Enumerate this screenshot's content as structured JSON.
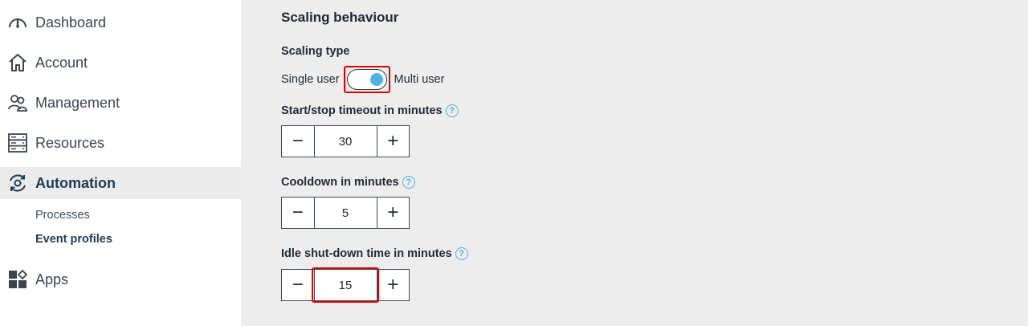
{
  "sidebar": {
    "items": [
      {
        "label": "Dashboard",
        "icon": "gauge-icon"
      },
      {
        "label": "Account",
        "icon": "home-icon"
      },
      {
        "label": "Management",
        "icon": "users-icon"
      },
      {
        "label": "Resources",
        "icon": "server-icon"
      },
      {
        "label": "Automation",
        "icon": "automation-gear-icon"
      },
      {
        "label": "Apps",
        "icon": "apps-grid-icon"
      }
    ],
    "subitems": [
      {
        "label": "Processes"
      },
      {
        "label": "Event profiles"
      }
    ]
  },
  "main": {
    "section_title": "Scaling behaviour",
    "scaling_type": {
      "label": "Scaling type",
      "left_option": "Single user",
      "right_option": "Multi user"
    },
    "start_stop": {
      "label": "Start/stop timeout in minutes",
      "value": "30"
    },
    "cooldown": {
      "label": "Cooldown in minutes",
      "value": "5"
    },
    "idle": {
      "label": "Idle shut-down time in minutes",
      "value": "15"
    },
    "help_glyph": "?",
    "minus_glyph": "−",
    "plus_glyph": "+"
  },
  "colors": {
    "accent": "#4fb3e0",
    "highlight": "#e00000",
    "active_nav": "#1d3c55"
  }
}
